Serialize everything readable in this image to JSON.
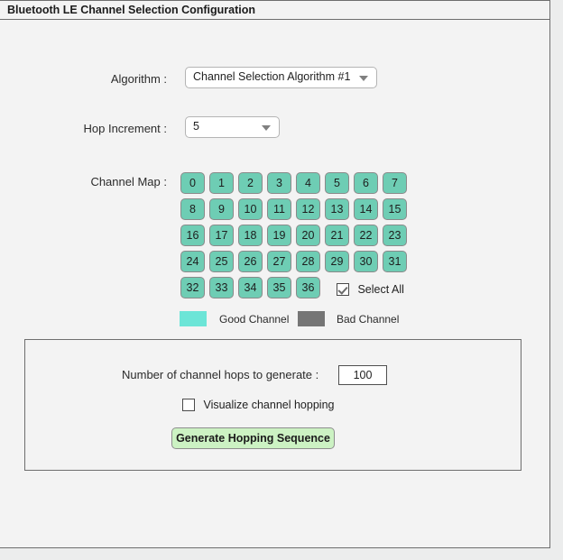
{
  "window": {
    "title": "Bluetooth LE Channel Selection Configuration"
  },
  "form": {
    "algorithm_label": "Algorithm :",
    "algorithm_value": "Channel Selection Algorithm #1",
    "hop_increment_label": "Hop Increment :",
    "hop_increment_value": "5",
    "channel_map_label": "Channel Map :"
  },
  "channel_map": {
    "rows": [
      [
        "0",
        "1",
        "2",
        "3",
        "4",
        "5",
        "6",
        "7"
      ],
      [
        "8",
        "9",
        "10",
        "11",
        "12",
        "13",
        "14",
        "15"
      ],
      [
        "16",
        "17",
        "18",
        "19",
        "20",
        "21",
        "22",
        "23"
      ],
      [
        "24",
        "25",
        "26",
        "27",
        "28",
        "29",
        "30",
        "31"
      ],
      [
        "32",
        "33",
        "34",
        "35",
        "36"
      ]
    ],
    "select_all_label": "Select All",
    "select_all_checked": true
  },
  "legend": {
    "good_label": "Good Channel",
    "good_color": "#6ce5d7",
    "bad_label": "Bad Channel",
    "bad_color": "#757575"
  },
  "generate_panel": {
    "hops_label": "Number of channel hops to generate :",
    "hops_value": "100",
    "visualize_label": "Visualize channel hopping",
    "visualize_checked": false,
    "generate_button_label": "Generate Hopping Sequence"
  }
}
